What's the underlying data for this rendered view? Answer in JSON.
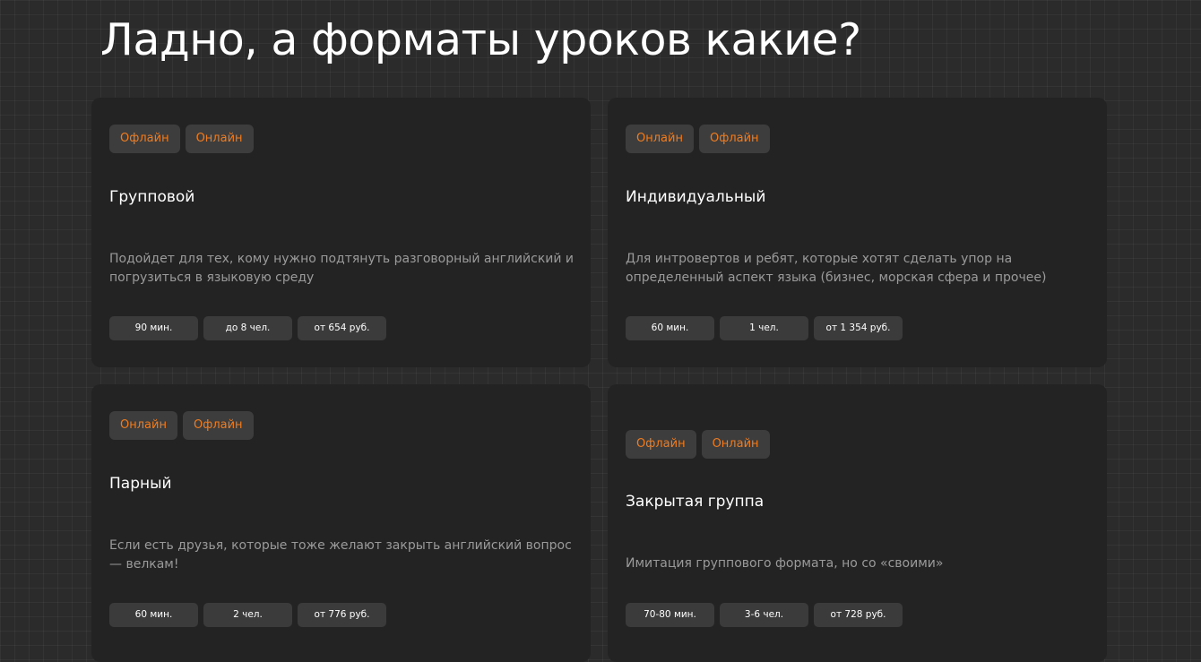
{
  "page": {
    "title": "Ладно, а форматы уроков какие?"
  },
  "colors": {
    "accent": "#f07c1f",
    "background": "#2b2b2b",
    "card": "#232323",
    "chip": "#3b3b3b",
    "text": "#ffffff",
    "muted_text": "#9a9a9a"
  },
  "cards": [
    {
      "tags": [
        "Офлайн",
        "Онлайн"
      ],
      "title": "Групповой",
      "description": "Подойдет для тех, кому нужно подтянуть разговорный английский и погрузиться в языковую среду",
      "details": {
        "duration": "90 мин.",
        "group_size": "до 8 чел.",
        "price": "от 654 руб."
      }
    },
    {
      "tags": [
        "Онлайн",
        "Офлайн"
      ],
      "title": "Индивидуальный",
      "description": "Для интровертов и ребят, которые хотят сделать упор на определенный аспект языка (бизнес, морская сфера и прочее)",
      "details": {
        "duration": "60 мин.",
        "group_size": "1 чел.",
        "price": "от 1 354 руб."
      }
    },
    {
      "tags": [
        "Онлайн",
        "Офлайн"
      ],
      "title": "Парный",
      "description": "Если есть друзья, которые тоже желают закрыть английский вопрос — велкам!",
      "details": {
        "duration": "60 мин.",
        "group_size": "2 чел.",
        "price": "от 776 руб."
      }
    },
    {
      "tags": [
        "Офлайн",
        "Онлайн"
      ],
      "title": "Закрытая группа",
      "description": "Имитация группового формата, но со «своими»",
      "details": {
        "duration": "70-80 мин.",
        "group_size": "3-6 чел.",
        "price": "от 728 руб."
      }
    }
  ]
}
